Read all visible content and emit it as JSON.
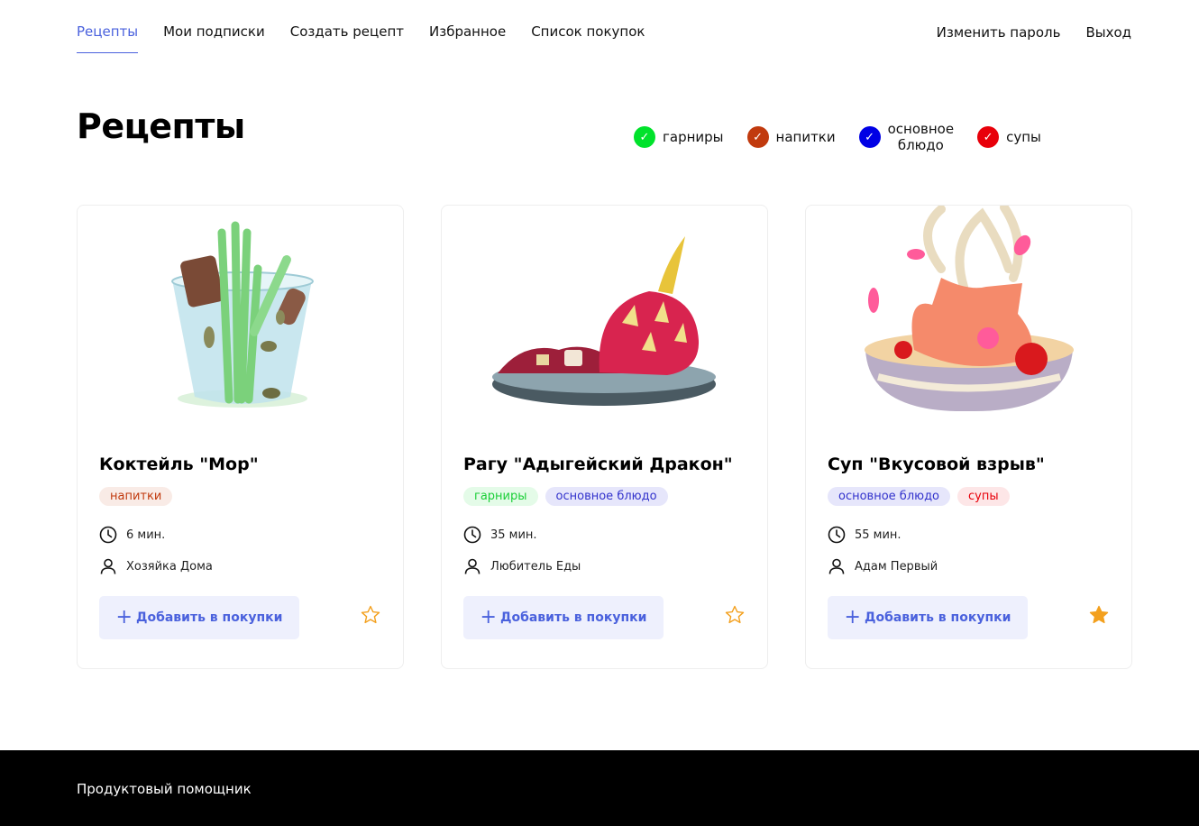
{
  "nav": {
    "left": [
      {
        "label": "Рецепты",
        "active": true
      },
      {
        "label": "Мои подписки"
      },
      {
        "label": "Создать рецепт"
      },
      {
        "label": "Избранное"
      },
      {
        "label": "Список покупок"
      }
    ],
    "change_password": "Изменить пароль",
    "logout": "Выход"
  },
  "page": {
    "title": "Рецепты"
  },
  "filters": [
    {
      "label": "гарниры",
      "color": "#00e22b"
    },
    {
      "label": "напитки",
      "color": "#c13a0e"
    },
    {
      "label_line1": "основное",
      "label_line2": "блюдо",
      "color": "#0000e5"
    },
    {
      "label": "супы",
      "color": "#e8000a"
    }
  ],
  "cards": [
    {
      "title": "Коктейль \"Мор\"",
      "tags": [
        {
          "label": "напитки",
          "color": "#c13a0e",
          "bg": "#f9ebe6"
        }
      ],
      "time": "6 мин.",
      "author": "Хозяйка Дома",
      "add_label": "Добавить в покупки",
      "favorite": false,
      "image_icon": "cocktail-glass-illustration"
    },
    {
      "title": "Рагу \"Адыгейский Дракон\"",
      "tags": [
        {
          "label": "гарниры",
          "color": "#1bcf38",
          "bg": "#e4fbe8"
        },
        {
          "label": "основное блюдо",
          "color": "#3333cc",
          "bg": "#e6e6fb"
        }
      ],
      "time": "35 мин.",
      "author": "Любитель Еды",
      "add_label": "Добавить в покупки",
      "favorite": false,
      "image_icon": "dragonfruit-plate-illustration"
    },
    {
      "title": "Суп \"Вкусовой взрыв\"",
      "tags": [
        {
          "label": "основное блюдо",
          "color": "#3333cc",
          "bg": "#e6e6fb"
        },
        {
          "label": "супы",
          "color": "#e8000a",
          "bg": "#fde6e7"
        }
      ],
      "time": "55 мин.",
      "author": "Адам Первый",
      "add_label": "Добавить в покупки",
      "favorite": true,
      "image_icon": "soup-bowl-illustration"
    }
  ],
  "footer": {
    "text": "Продуктовый помощник"
  },
  "colors": {
    "accent": "#4a61dd",
    "star": "#f3a01e"
  }
}
